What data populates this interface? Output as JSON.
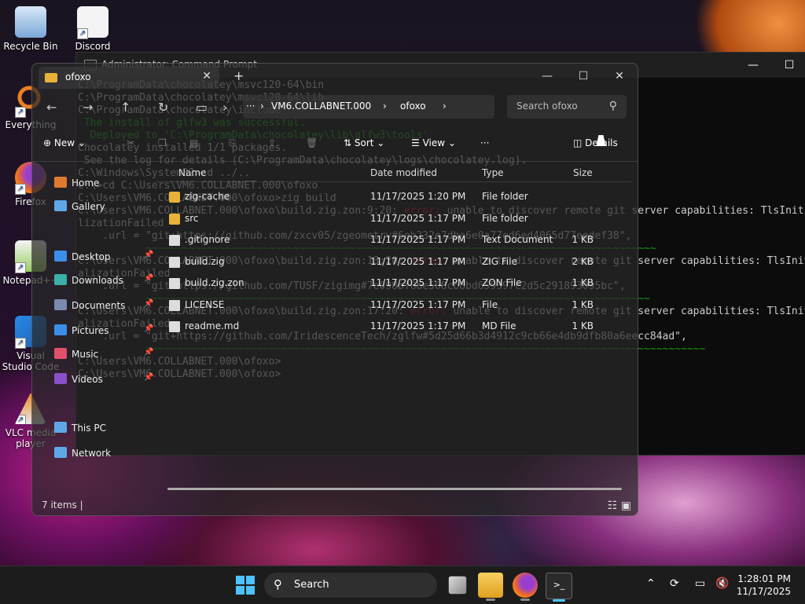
{
  "desktop": {
    "icons": [
      {
        "label": "Recycle Bin"
      },
      {
        "label": "Discord"
      },
      {
        "label": "Everything"
      },
      {
        "label": "Firefox"
      },
      {
        "label": "Notepad++"
      },
      {
        "label": "Visual Studio Code"
      },
      {
        "label": "VLC media player"
      }
    ]
  },
  "cmd": {
    "title": "Administrator: Command Prompt",
    "lines": [
      {
        "t": "C:\\ProgramData\\chocolatey\\msvc120-64\\bin",
        "c": ""
      },
      {
        "t": "C:\\ProgramData\\chocolatey\\msvc120-64\\lib",
        "c": ""
      },
      {
        "t": "C:\\ProgramData\\chocolatey\\include",
        "c": ""
      },
      {
        "t": " The install of glfw3 was successful.",
        "c": "ok"
      },
      {
        "t": "  Deployed to 'C:\\ProgramData\\chocolatey\\lib\\glfw3\\tools'",
        "c": "ok"
      },
      {
        "t": "",
        "c": ""
      },
      {
        "t": "Chocolatey installed 1/1 packages.",
        "c": ""
      },
      {
        "t": " See the log for details (C:\\ProgramData\\chocolatey\\logs\\chocolatey.log).",
        "c": ""
      },
      {
        "t": "",
        "c": ""
      },
      {
        "t": "C:\\Windows\\System32>cd ../..",
        "c": ""
      },
      {
        "t": "",
        "c": ""
      },
      {
        "t": "C:\\>cd C:\\Users\\VM6.COLLABNET.000\\ofoxo",
        "c": ""
      },
      {
        "t": "",
        "c": ""
      },
      {
        "t": "C:\\Users\\VM6.COLLABNET.000\\ofoxo>zig build",
        "c": ""
      },
      {
        "t": "C:\\Users\\VM6.COLLABNET.000\\ofoxo\\build.zig.zon:9:20: ",
        "c": "",
        "e": "error:",
        "r": " unable to discover remote git server capabilities: TlsInitia"
      },
      {
        "t": "lizationFailed",
        "c": ""
      },
      {
        "t": "    .url = \"git+https://github.com/zxcv05/zgeometry#6eb232e7dbe6e0a77ed6ed4065d77eedef38\",",
        "c": ""
      },
      {
        "t": "           ~~~~~~~~~~~~~~~~~~~~~~~~~~~~~~~~~~~~~~~~~~~~~~~~~~~~~~~~~~~~~~~~~~~~~~~~~~~~~~~~~~~",
        "c": "squig"
      },
      {
        "t": "C:\\Users\\VM6.COLLABNET.000\\ofoxo\\build.zig.zon:13:20: ",
        "c": "",
        "e": "error:",
        "r": " unable to discover remote git server capabilities: TlsIniti"
      },
      {
        "t": "alizationFailed",
        "c": ""
      },
      {
        "t": "    .url = \"git+https://github.com/TUSF/zigimg#7e098bf6be568cb8bd659397c2d5c291893095bc\",",
        "c": ""
      },
      {
        "t": "           ~~~~~~~~~~~~~~~~~~~~~~~~~~~~~~~~~~~~~~~~~~~~~~~~~~~~~~~~~~~~~~~~~~~~~~~~~~~~~~~~~~",
        "c": "squig"
      },
      {
        "t": "C:\\Users\\VM6.COLLABNET.000\\ofoxo\\build.zig.zon:17:20: ",
        "c": "",
        "e": "error:",
        "r": " unable to discover remote git server capabilities: TlsIniti"
      },
      {
        "t": "alizationFailed",
        "c": ""
      },
      {
        "t": "    .url = \"git+https://github.com/IridescenceTech/zglfw#5d25d66b3d4912c9cb66e4db9dfb80a6eecc84ad\",",
        "c": ""
      },
      {
        "t": "           ~~~~~~~~~~~~~~~~~~~~~~~~~~~~~~~~~~~~~~~~~~~~~~~~~~~~~~~~~~~~~~~~~~~~~~~~~~~~~~~~~~~~~~~~~~~",
        "c": "squig"
      },
      {
        "t": "",
        "c": ""
      },
      {
        "t": "C:\\Users\\VM6.COLLABNET.000\\ofoxo>",
        "c": ""
      },
      {
        "t": "",
        "c": ""
      },
      {
        "t": "C:\\Users\\VM6.COLLABNET.000\\ofoxo>",
        "c": ""
      }
    ]
  },
  "explorer": {
    "tab_label": "ofoxo",
    "breadcrumb": [
      "VM6.COLLABNET.000",
      "ofoxo"
    ],
    "search_placeholder": "Search ofoxo",
    "cmd_new": "New",
    "cmd_sort": "Sort",
    "cmd_view": "View",
    "cmd_more": "···",
    "cmd_details": "Details",
    "sidebar": [
      {
        "label": "Home",
        "color": "#e07a2f"
      },
      {
        "label": "Gallery",
        "color": "#5fa8e8"
      },
      {
        "label": "Desktop",
        "color": "#3a8ee8"
      },
      {
        "label": "Downloads",
        "color": "#3ab0a8"
      },
      {
        "label": "Documents",
        "color": "#7a8ab0"
      },
      {
        "label": "Pictures",
        "color": "#3a8ee8"
      },
      {
        "label": "Music",
        "color": "#e0506a"
      },
      {
        "label": "Videos",
        "color": "#8a50c8"
      },
      {
        "label": "This PC",
        "color": "#5fa8e8"
      },
      {
        "label": "Network",
        "color": "#5fa8e8"
      }
    ],
    "columns": {
      "name": "Name",
      "date": "Date modified",
      "type": "Type",
      "size": "Size"
    },
    "files": [
      {
        "name": "zig-cache",
        "date": "11/17/2025 1:20 PM",
        "type": "File folder",
        "size": "",
        "kind": "folder"
      },
      {
        "name": "src",
        "date": "11/17/2025 1:17 PM",
        "type": "File folder",
        "size": "",
        "kind": "folder"
      },
      {
        "name": ".gitignore",
        "date": "11/17/2025 1:17 PM",
        "type": "Text Document",
        "size": "1 KB",
        "kind": "doc"
      },
      {
        "name": "build.zig",
        "date": "11/17/2025 1:17 PM",
        "type": "ZIG File",
        "size": "2 KB",
        "kind": "doc"
      },
      {
        "name": "build.zig.zon",
        "date": "11/17/2025 1:17 PM",
        "type": "ZON File",
        "size": "1 KB",
        "kind": "doc"
      },
      {
        "name": "LICENSE",
        "date": "11/17/2025 1:17 PM",
        "type": "File",
        "size": "1 KB",
        "kind": "doc"
      },
      {
        "name": "readme.md",
        "date": "11/17/2025 1:17 PM",
        "type": "MD File",
        "size": "1 KB",
        "kind": "doc"
      }
    ],
    "status": "7 items  |"
  },
  "taskbar": {
    "search_label": "Search",
    "time": "1:28:01 PM",
    "date": "11/17/2025"
  }
}
